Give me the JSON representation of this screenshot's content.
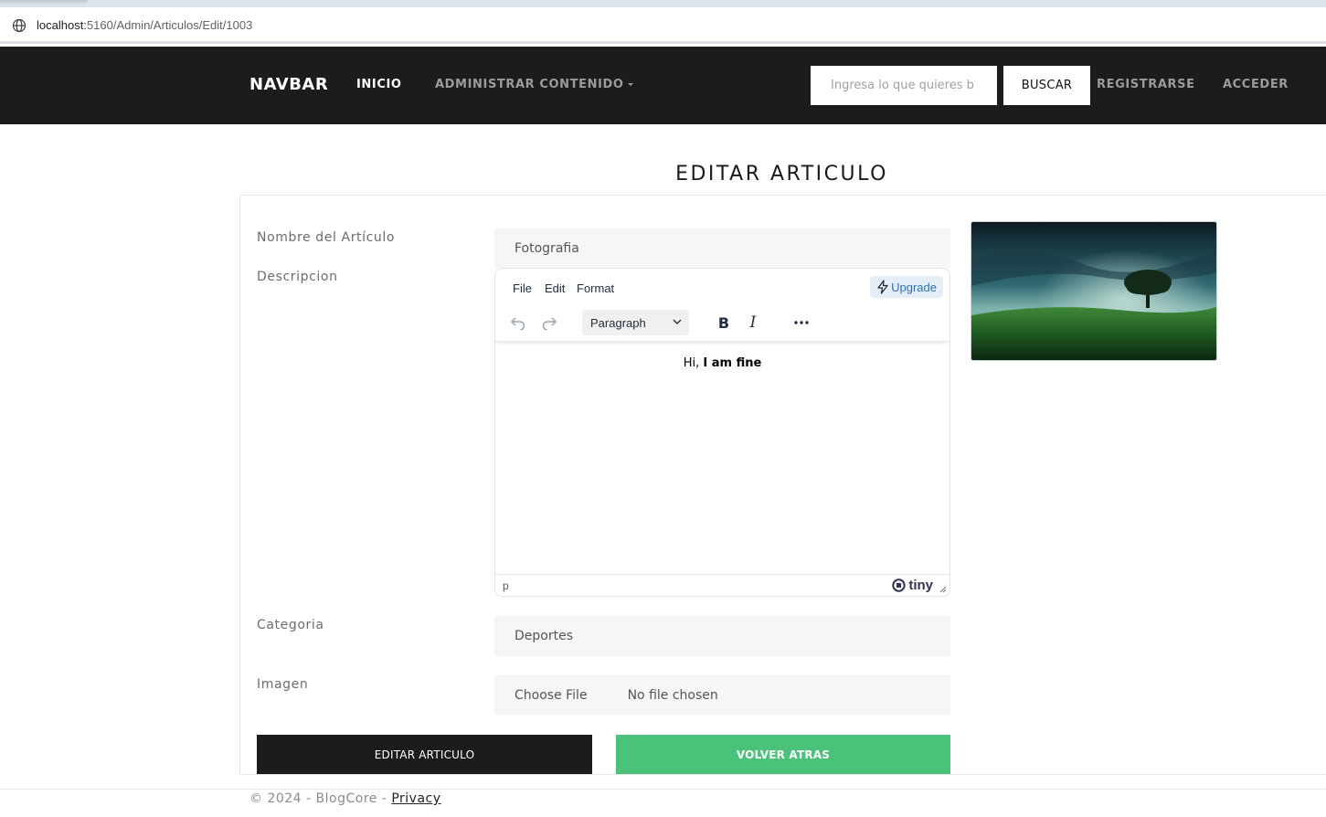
{
  "browser": {
    "url_host": "localhost:",
    "url_path": "5160/Admin/Articulos/Edit/1003"
  },
  "navbar": {
    "brand": "NAVBAR",
    "inicio": "INICIO",
    "administrar": "ADMINISTRAR CONTENIDO",
    "search_placeholder": "Ingresa lo que quieres b",
    "search_button": "BUSCAR",
    "registrarse": "REGISTRARSE",
    "acceder": "ACCEDER"
  },
  "page": {
    "title": "EDITAR ARTICULO"
  },
  "form": {
    "nombre_label": "Nombre del Artículo",
    "nombre_value": "Fotografia",
    "descripcion_label": "Descripcion",
    "categoria_label": "Categoria",
    "categoria_value": "Deportes",
    "imagen_label": "Imagen",
    "file_choose": "Choose File",
    "file_status": "No file chosen"
  },
  "editor": {
    "menu": [
      "File",
      "Edit",
      "Format"
    ],
    "upgrade": "Upgrade",
    "block_format": "Paragraph",
    "content_prefix": "Hi, ",
    "content_bold": "I am fine",
    "status_path": "p",
    "brand": "tiny"
  },
  "buttons": {
    "edit": "EDITAR ARTICULO",
    "back": "VOLVER ATRAS"
  },
  "footer": {
    "text": "© 2024 - BlogCore - ",
    "privacy": "Privacy"
  },
  "colors": {
    "navbar_bg": "#1c1c1c",
    "back_button": "#4bc27a",
    "edit_button": "#1c1c1c",
    "upgrade_accent": "#2f6fb3"
  }
}
